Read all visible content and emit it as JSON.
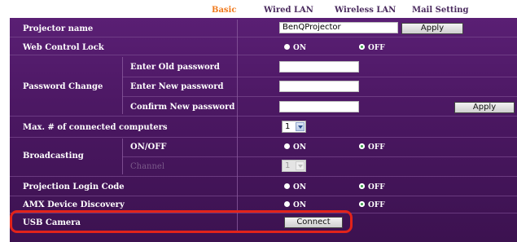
{
  "tabs": [
    {
      "label": "Basic",
      "active": true
    },
    {
      "label": "Wired LAN",
      "active": false
    },
    {
      "label": "Wireless LAN",
      "active": false
    },
    {
      "label": "Mail Setting",
      "active": false
    }
  ],
  "projector_name": {
    "label": "Projector name",
    "value": "BenQProjector",
    "apply": "Apply"
  },
  "web_control_lock": {
    "label": "Web Control Lock",
    "on": "ON",
    "off": "OFF",
    "selected": "OFF"
  },
  "password_change": {
    "label": "Password Change",
    "old": "Enter Old password",
    "new": "Enter New password",
    "confirm": "Confirm New password",
    "apply": "Apply"
  },
  "max_connected": {
    "label": "Max. # of connected computers",
    "value": "1"
  },
  "broadcasting": {
    "label": "Broadcasting",
    "onoff_label": "ON/OFF",
    "on": "ON",
    "off": "OFF",
    "selected": "OFF",
    "channel_label": "Channel",
    "channel_value": "1"
  },
  "projection_login": {
    "label": "Projection Login Code",
    "on": "ON",
    "off": "OFF",
    "selected": "OFF"
  },
  "amx": {
    "label": "AMX Device Discovery",
    "on": "ON",
    "off": "OFF",
    "selected": "OFF"
  },
  "usb_camera": {
    "label": "USB Camera",
    "button": "Connect"
  },
  "colors": {
    "panel": "#4a1761",
    "active_tab": "#f07a1d",
    "highlight": "#e2231a",
    "radio_checked": "#3aa04a"
  }
}
